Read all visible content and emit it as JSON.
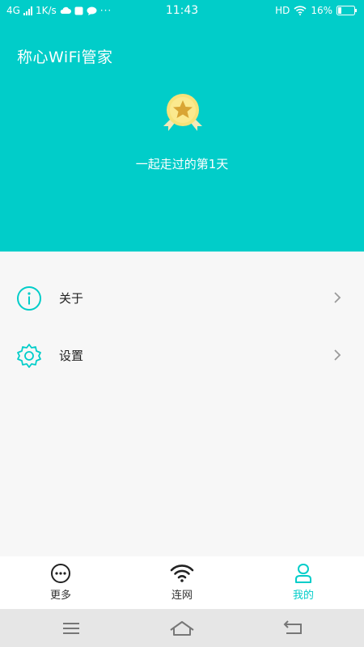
{
  "status_bar": {
    "network": "4G",
    "speed": "1K/s",
    "time": "11:43",
    "hd": "HD",
    "battery": "16%"
  },
  "header": {
    "app_title": "称心WiFi管家",
    "days_text": "一起走过的第1天"
  },
  "menu": {
    "items": [
      {
        "label": "关于",
        "icon": "info-icon"
      },
      {
        "label": "设置",
        "icon": "gear-icon"
      }
    ]
  },
  "tabs": [
    {
      "label": "更多",
      "icon": "more-dots-icon",
      "active": false
    },
    {
      "label": "连网",
      "icon": "wifi-icon",
      "active": false
    },
    {
      "label": "我的",
      "icon": "user-icon",
      "active": true
    }
  ],
  "colors": {
    "accent": "#01cdc9",
    "background": "#f7f7f7",
    "tabbar": "#ffffff",
    "navbar": "#e6e6e6"
  }
}
